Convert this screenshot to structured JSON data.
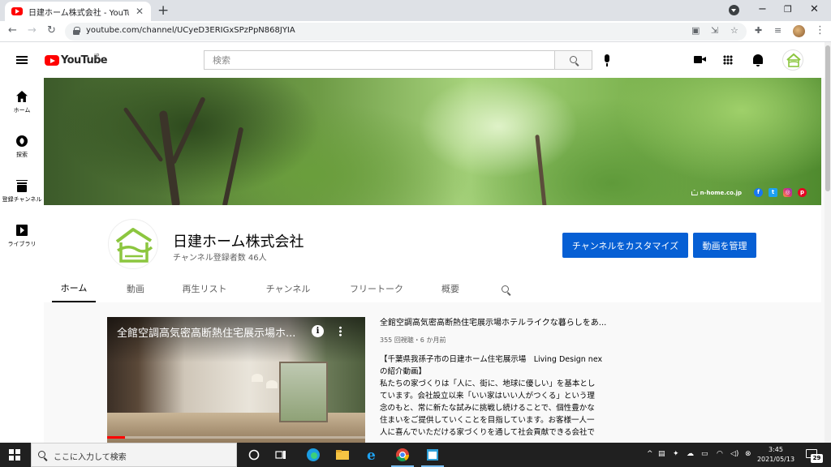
{
  "browser": {
    "tab_title": "日建ホーム株式会社 - YouTube",
    "url": "youtube.com/channel/UCyeD3ERIGxSPzPpN868JYIA"
  },
  "youtube": {
    "logo_text": "YouTube",
    "region": "JP",
    "search_placeholder": "検索"
  },
  "guide": {
    "items": [
      {
        "label": "ホーム",
        "icon": "home-icon"
      },
      {
        "label": "探索",
        "icon": "explore-icon"
      },
      {
        "label": "登録チャンネル",
        "icon": "subscriptions-icon"
      },
      {
        "label": "ライブラリ",
        "icon": "library-icon"
      }
    ]
  },
  "banner": {
    "site": "n-home.co.jp",
    "social": [
      "facebook-icon",
      "twitter-icon",
      "instagram-icon",
      "pinterest-icon"
    ]
  },
  "channel": {
    "name": "日建ホーム株式会社",
    "subscribers": "チャンネル登録者数 46人",
    "customize_label": "チャンネルをカスタマイズ",
    "manage_label": "動画を管理",
    "tabs": [
      "ホーム",
      "動画",
      "再生リスト",
      "チャンネル",
      "フリートーク",
      "概要"
    ],
    "active_tab": "ホーム"
  },
  "featured": {
    "player_title": "全館空調高気密高断熱住宅展示場ホ...",
    "heading": "全館空調高気密高断熱住宅展示場ホテルライクな暮らしをあ...",
    "views": "355 回視聴・6 か月前",
    "description": [
      "【千葉県我孫子市の日建ホーム住宅展示場　Living Design nex",
      "の紹介動画】",
      "私たちの家づくりは「人に、街に、地球に優しい」を基本とし",
      "ています。会社設立以来「いい家はいい人がつくる」という理",
      "念のもと、常に新たな試みに挑戦し続けることで、個性豊かな",
      "住まいをご提供していくことを目指しています。お客様一人一",
      "人に喜んでいただける家づくりを通して社会貢献できる会社で"
    ],
    "progress": 0.07
  },
  "taskbar": {
    "search_text": "ここに入力して検索",
    "time": "3:45",
    "date": "2021/05/13",
    "notification_count": "29"
  },
  "colors": {
    "accent_blue": "#065fd4",
    "youtube_red": "#ff0000",
    "brand_green": "#8cc63f"
  }
}
